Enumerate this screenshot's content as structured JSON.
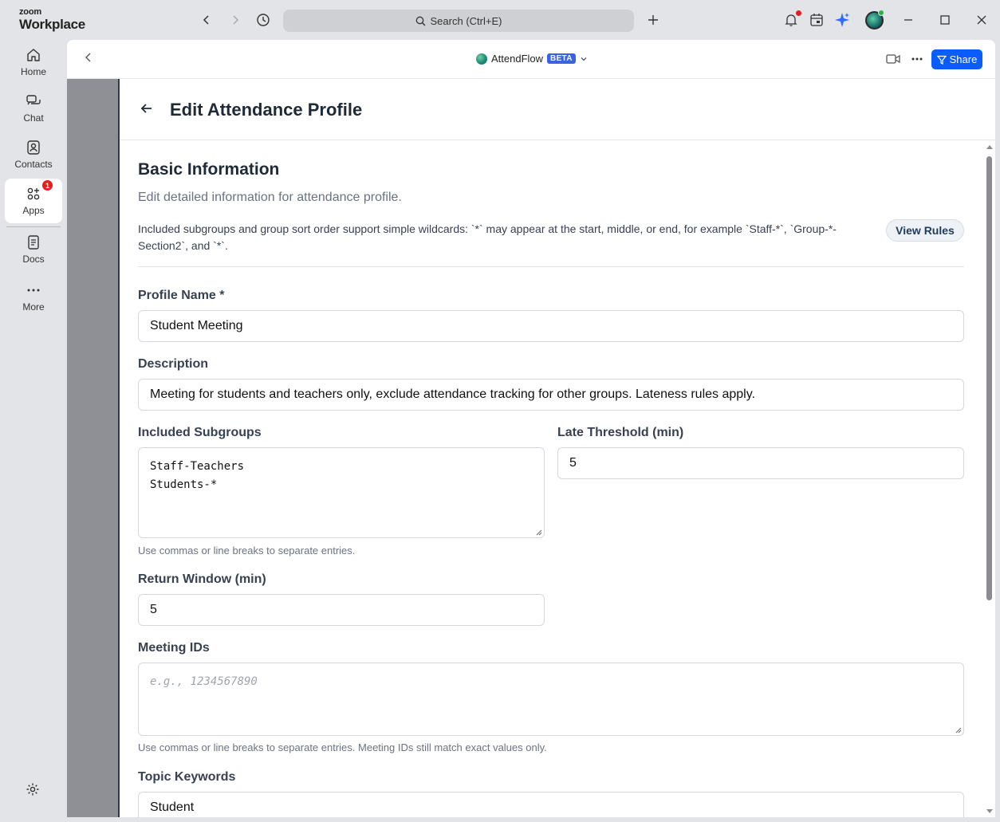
{
  "app": {
    "brand_small": "zoom",
    "brand_big": "Workplace"
  },
  "search": {
    "label": "Search (Ctrl+E)"
  },
  "sidebar": {
    "items": [
      {
        "label": "Home"
      },
      {
        "label": "Chat"
      },
      {
        "label": "Contacts"
      },
      {
        "label": "Apps",
        "badge": "1"
      },
      {
        "label": "Docs"
      },
      {
        "label": "More"
      }
    ]
  },
  "app_header": {
    "app_name": "AttendFlow",
    "badge": "BETA",
    "share_label": "Share"
  },
  "page": {
    "title": "Edit Attendance Profile",
    "section_title": "Basic Information",
    "section_subtitle": "Edit detailed information for attendance profile.",
    "hint": "Included subgroups and group sort order support simple wildcards: `*` may appear at the start, middle, or end, for example `Staff-*`, `Group-*-Section2`, and `*`.",
    "view_rules_label": "View Rules"
  },
  "form": {
    "profile_name": {
      "label": "Profile Name *",
      "value": "Student Meeting"
    },
    "description": {
      "label": "Description",
      "value": "Meeting for students and teachers only, exclude attendance tracking for other groups. Lateness rules apply."
    },
    "included_subgroups": {
      "label": "Included Subgroups",
      "value": "Staff-Teachers\nStudents-*",
      "help": "Use commas or line breaks to separate entries."
    },
    "late_threshold": {
      "label": "Late Threshold (min)",
      "value": "5"
    },
    "return_window": {
      "label": "Return Window (min)",
      "value": "5"
    },
    "meeting_ids": {
      "label": "Meeting IDs",
      "placeholder": "e.g., 1234567890",
      "help": "Use commas or line breaks to separate entries. Meeting IDs still match exact values only."
    },
    "topic_keywords": {
      "label": "Topic Keywords",
      "value": "Student"
    }
  },
  "colors": {
    "accent": "#0b5cff",
    "beta": "#3a63e0",
    "badge": "#e02020"
  }
}
